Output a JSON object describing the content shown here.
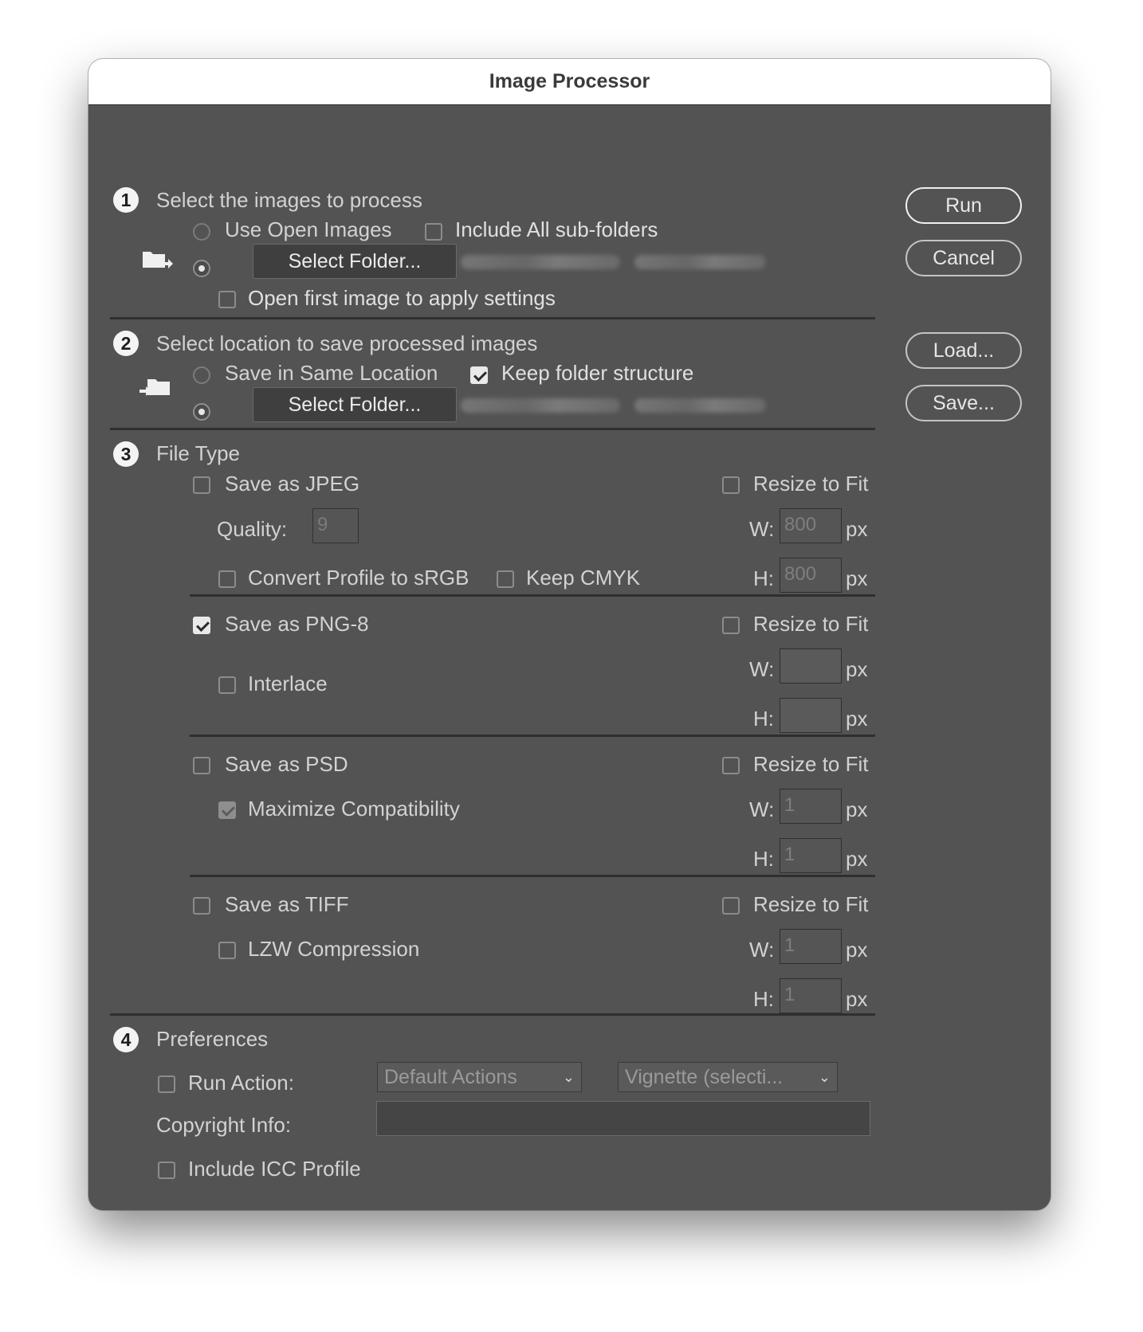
{
  "window": {
    "title": "Image Processor"
  },
  "section1": {
    "number": "1",
    "title": "Select the images to process",
    "use_open_images": "Use Open Images",
    "include_subfolders": "Include All sub-folders",
    "select_folder": "Select Folder...",
    "open_first_image": "Open first image to apply settings"
  },
  "section2": {
    "number": "2",
    "title": "Select location to save processed images",
    "save_same_location": "Save in Same Location",
    "keep_folder_structure": "Keep folder structure",
    "select_folder": "Select Folder..."
  },
  "section3": {
    "number": "3",
    "title": "File Type",
    "jpeg": {
      "save_label": "Save as JPEG",
      "resize": "Resize to Fit",
      "quality_label": "Quality:",
      "quality_value": "9",
      "w_label": "W:",
      "w_value": "800",
      "h_label": "H:",
      "h_value": "800",
      "unit": "px",
      "convert_profile": "Convert Profile to sRGB",
      "keep_cmyk": "Keep CMYK"
    },
    "png": {
      "save_label": "Save as PNG-8",
      "resize": "Resize to Fit",
      "interlace": "Interlace",
      "w_label": "W:",
      "w_value": "",
      "h_label": "H:",
      "h_value": "",
      "unit": "px"
    },
    "psd": {
      "save_label": "Save as PSD",
      "resize": "Resize to Fit",
      "maximize": "Maximize Compatibility",
      "w_label": "W:",
      "w_value": "1",
      "h_label": "H:",
      "h_value": "1",
      "unit": "px"
    },
    "tiff": {
      "save_label": "Save as TIFF",
      "resize": "Resize to Fit",
      "lzw": "LZW Compression",
      "w_label": "W:",
      "w_value": "1",
      "h_label": "H:",
      "h_value": "1",
      "unit": "px"
    }
  },
  "section4": {
    "number": "4",
    "title": "Preferences",
    "run_action": "Run Action:",
    "action_set": "Default Actions",
    "action_name": "Vignette (selecti...",
    "copyright_label": "Copyright Info:",
    "copyright_value": "",
    "include_icc": "Include ICC Profile"
  },
  "buttons": {
    "run": "Run",
    "cancel": "Cancel",
    "load": "Load...",
    "save": "Save..."
  }
}
